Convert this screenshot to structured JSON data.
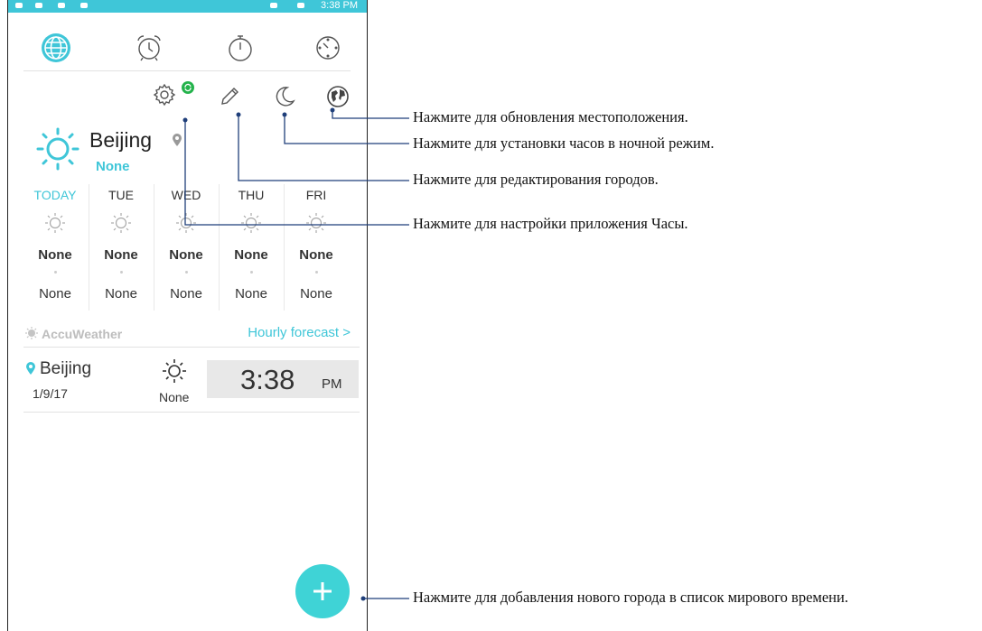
{
  "status_bar": {
    "time": "3:38 PM"
  },
  "tabs": [
    {
      "name": "world-clock",
      "icon": "globe-icon",
      "active": true
    },
    {
      "name": "alarm",
      "icon": "alarm-clock-icon"
    },
    {
      "name": "stopwatch",
      "icon": "stopwatch-icon"
    },
    {
      "name": "timer",
      "icon": "timer-icon"
    }
  ],
  "toolbar": {
    "icons": [
      "gear-icon",
      "sync-icon",
      "pencil-icon",
      "moon-icon",
      "earth-icon"
    ]
  },
  "current": {
    "city": "Beijing",
    "condition": "None"
  },
  "forecast": [
    {
      "day": "TODAY",
      "hi": "None",
      "lo": "None"
    },
    {
      "day": "TUE",
      "hi": "None",
      "lo": "None"
    },
    {
      "day": "WED",
      "hi": "None",
      "lo": "None"
    },
    {
      "day": "THU",
      "hi": "None",
      "lo": "None"
    },
    {
      "day": "FRI",
      "hi": "None",
      "lo": "None"
    }
  ],
  "accu": {
    "brand": "AccuWeather",
    "hourly_label": "Hourly forecast >"
  },
  "world_clock_row": {
    "city": "Beijing",
    "date": "1/9/17",
    "condition": "None",
    "time": "3:38",
    "ampm": "PM"
  },
  "callouts": {
    "location": "Нажмите для обновления местоположения.",
    "night_mode": "Нажмите для установки часов в ночной режим.",
    "edit_cities": "Нажмите для редактирования городов.",
    "settings": "Нажмите для настройки приложения Часы.",
    "add_city": "Нажмите для добавления нового города в список мирового времени."
  },
  "colors": {
    "accent": "#3fc6d8",
    "fab": "#3fd3d6",
    "sync_badge": "#24b34c",
    "callout_line": "#1f3f7a"
  }
}
